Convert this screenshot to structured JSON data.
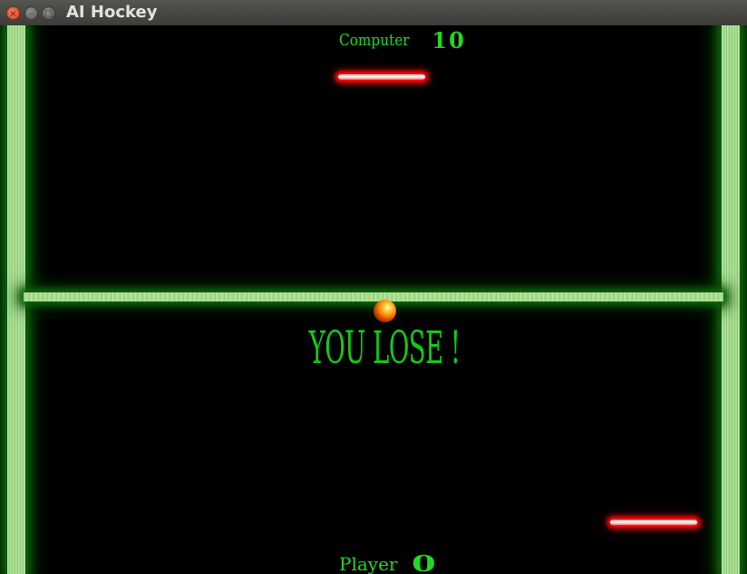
{
  "window": {
    "title": "AI Hockey",
    "close_glyph": "×",
    "minimize_glyph": "–",
    "maximize_glyph": "□"
  },
  "scoreboard": {
    "computer_label": "Computer",
    "computer_score": "10",
    "player_label": "Player",
    "player_score": "0"
  },
  "message": "YOU LOSE !",
  "colors": {
    "field": "#000000",
    "wall_glow": "#0c6a0a",
    "score_text": "#22d822",
    "paddle_glow": "#ff0d0d",
    "puck": "#ff8a00"
  }
}
